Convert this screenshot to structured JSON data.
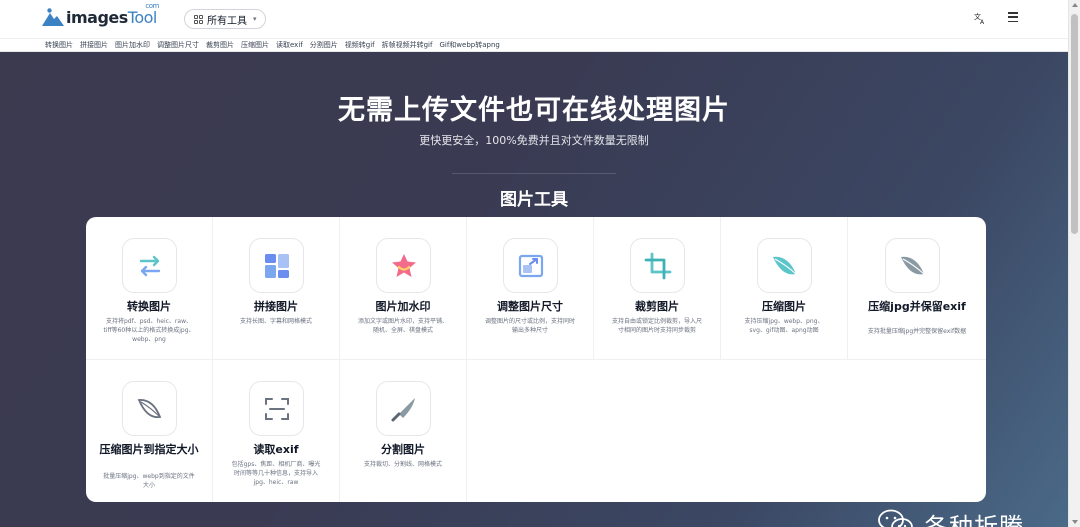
{
  "header": {
    "logo": {
      "main": "images",
      "tool": "Tool",
      "com": "com"
    },
    "tools_dropdown": "所有工具",
    "icons": [
      "translate-icon",
      "menu-icon",
      "grid-icon",
      "chevron-down-icon"
    ]
  },
  "subnav": [
    "转换图片",
    "拼接图片",
    "图片加水印",
    "调整图片尺寸",
    "裁剪图片",
    "压缩图片",
    "读取exif",
    "分割图片",
    "视频转gif",
    "拆帧视频并转gif",
    "Gif和webp转apng"
  ],
  "hero": {
    "title": "无需上传文件也可在线处理图片",
    "subtitle": "更快更安全，100%免费并且对文件数量无限制",
    "section": "图片工具"
  },
  "cards": [
    {
      "title": "转换图片",
      "desc": "支持将pdf、psd、heic、raw、tiff等60种以上的格式转换成jpg、webp、png",
      "icon": "convert-arrows-icon"
    },
    {
      "title": "拼接图片",
      "desc": "支持长图、字幕和网格模式",
      "icon": "grid-layout-icon"
    },
    {
      "title": "图片加水印",
      "desc": "添加文字或图片水印，支持平铺、随机、全屏、棋盘模式",
      "icon": "star-watermark-icon"
    },
    {
      "title": "调整图片尺寸",
      "desc": "调整图片的尺寸或比例，支持同时输出多种尺寸",
      "icon": "resize-icon"
    },
    {
      "title": "裁剪图片",
      "desc": "支持自由或锁定比例裁剪，导入尺寸相同的图片时支持同步裁剪",
      "icon": "crop-icon"
    },
    {
      "title": "压缩图片",
      "desc": "支持压缩jpg、webp、png、svg、gif动图、apng动图",
      "icon": "feather-icon"
    },
    {
      "title": "压缩jpg并保留exif",
      "desc": "支持批量压缩jpg并完整保留exif数据",
      "icon": "feather-gray-icon"
    },
    {
      "title": "压缩图片到指定大小",
      "desc": "批量压缩jpg、webp到指定的文件大小",
      "icon": "feather-outline-icon"
    },
    {
      "title": "读取exif",
      "desc": "包括gps、焦距、相机厂商、曝光时间等等几十种信息，支持导入jpg、heic、raw",
      "icon": "scan-exif-icon"
    },
    {
      "title": "分割图片",
      "desc": "支持裁切、分割线、网格模式",
      "icon": "knife-icon"
    }
  ],
  "watermark": {
    "text": "各种折腾",
    "icon": "wechat-icon"
  },
  "colors": {
    "hero_from": "#3b3a4f",
    "hero_to": "#4a6a88",
    "accent": "#3b82c4",
    "icon_blue": "#7aa7f0",
    "icon_teal": "#5bc5c9",
    "icon_pink": "#f26b8a"
  }
}
